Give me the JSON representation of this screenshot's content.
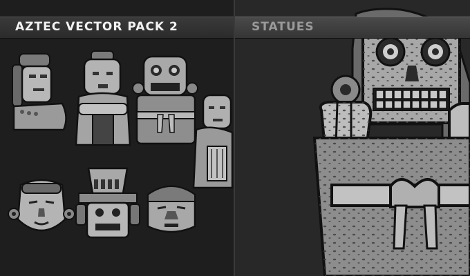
{
  "header": {
    "title": "AZTEC VECTOR PACK 2",
    "subtitle": "STATUES"
  },
  "colors": {
    "background": "#1e1e1e",
    "right_panel": "#282828",
    "stone_light": "#bdbdbd",
    "stone_mid": "#8a8a8a",
    "stone_dark": "#3d3d3d",
    "title_text": "#f2f2f2",
    "subtitle_text": "#9a9a9a"
  },
  "figures": [
    {
      "name": "seated-warrior-statue"
    },
    {
      "name": "crouching-figure-statue"
    },
    {
      "name": "skull-deity-statue"
    },
    {
      "name": "kneeling-woman-statue"
    },
    {
      "name": "mask-with-earrings"
    },
    {
      "name": "tlaloc-headdress-statue"
    },
    {
      "name": "olmec-head-statue"
    }
  ],
  "featured": {
    "name": "large-skull-deity-statue"
  }
}
